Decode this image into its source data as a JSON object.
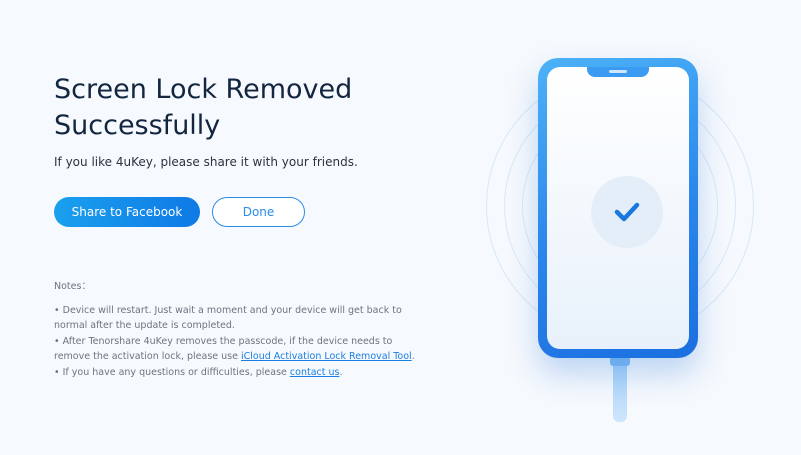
{
  "main": {
    "title": "Screen Lock Removed Successfully",
    "subtitle": "If you like 4uKey, please share it with your friends.",
    "share_button": "Share to Facebook",
    "done_button": "Done"
  },
  "notes": {
    "heading": "Notes：",
    "items": [
      {
        "text": "• Device will restart. Just wait a moment and your device will get back to normal after the update is completed."
      },
      {
        "text_before": "• After Tenorshare 4uKey removes the passcode, if the device needs to remove the activation lock, please use ",
        "link": "iCloud Activation Lock Removal Tool",
        "text_after": "."
      },
      {
        "text_before": "• If you have any questions or difficulties, please ",
        "link": "contact us",
        "text_after": "."
      }
    ]
  },
  "illustration": {
    "icons": [
      "phone-icon",
      "checkmark-icon",
      "cable-icon"
    ]
  },
  "colors": {
    "primary": "#0f79e6",
    "title": "#12263f",
    "link": "#1b7fe0",
    "background": "#f6f9fd"
  }
}
